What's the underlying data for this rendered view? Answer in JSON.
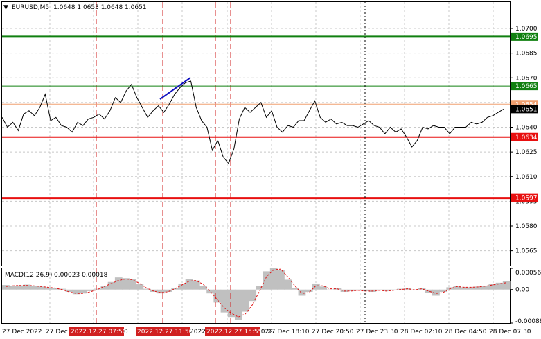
{
  "header": {
    "menu_glyph": "▼",
    "symbol": "EURUSD,M5",
    "ohlc": "1.0648 1.0653 1.0648 1.0651"
  },
  "indicator": {
    "label": "MACD(12,26,9)",
    "values": "0.00023 0.00018"
  },
  "colors": {
    "price_line": "#000000",
    "resistance": "#108010",
    "support": "#e81010",
    "bid": "#f0a070",
    "grid": "#c8c8c8",
    "event_line": "#d02020",
    "macd_hist": "#c0c0c0",
    "signal": "#e01010",
    "trend_line": "#1010c0",
    "current_price_tag": "#000000"
  },
  "chart_data": {
    "type": "line",
    "price_axis_ticks": [
      "1.0700",
      "1.0685",
      "1.0670",
      "1.0655",
      "1.0640",
      "1.0625",
      "1.0610",
      "1.0595",
      "1.0580",
      "1.0565"
    ],
    "time_axis_labels": [
      "27 Dec 2022",
      "27 Dec",
      "0",
      "27 Dec 18:10",
      "27 Dec 20:50",
      "27 Dec 23:30",
      "28 Dec 02:10",
      "28 Dec 04:50",
      "28 Dec 07:30"
    ],
    "highlighted_time_labels": [
      "2022.12.27 07:50",
      "2022.12.27 11:50",
      "2022.12.27 15:55"
    ],
    "time_partial_labels": [
      "2022",
      "2022"
    ],
    "price_ylim": [
      1.0556,
      1.0716
    ],
    "levels": [
      {
        "value": 1.0695,
        "label": "1.0695",
        "kind": "resistance",
        "width": 3
      },
      {
        "value": 1.0665,
        "label": "1.0665",
        "kind": "resistance",
        "width": 1
      },
      {
        "value": 1.0654,
        "label": "1.0654",
        "kind": "bid",
        "width": 1
      },
      {
        "value": 1.0634,
        "label": "1.0634",
        "kind": "support",
        "width": 2
      },
      {
        "value": 1.0597,
        "label": "1.0597",
        "kind": "support",
        "width": 3
      }
    ],
    "current_price": {
      "value": 1.0651,
      "label": "1.0651"
    },
    "price_series": [
      1.0646,
      1.064,
      1.0643,
      1.0638,
      1.0648,
      1.065,
      1.0647,
      1.0652,
      1.066,
      1.0644,
      1.0646,
      1.0641,
      1.064,
      1.0637,
      1.0643,
      1.0641,
      1.0645,
      1.0646,
      1.0648,
      1.0645,
      1.065,
      1.0658,
      1.0655,
      1.0662,
      1.0666,
      1.0658,
      1.0652,
      1.0646,
      1.065,
      1.0653,
      1.0649,
      1.0654,
      1.066,
      1.0664,
      1.0667,
      1.0668,
      1.0652,
      1.0644,
      1.064,
      1.0626,
      1.0632,
      1.0622,
      1.0618,
      1.0627,
      1.0645,
      1.0652,
      1.0649,
      1.0652,
      1.0655,
      1.0646,
      1.065,
      1.064,
      1.0637,
      1.0641,
      1.064,
      1.0644,
      1.0644,
      1.065,
      1.0656,
      1.0646,
      1.0643,
      1.0645,
      1.0642,
      1.0643,
      1.0641,
      1.0641,
      1.064,
      1.0642,
      1.0644,
      1.0641,
      1.064,
      1.0636,
      1.064,
      1.0637,
      1.0639,
      1.0634,
      1.0628,
      1.0632,
      1.064,
      1.0639,
      1.0641,
      1.064,
      1.064,
      1.0636,
      1.064,
      1.064,
      1.064,
      1.0643,
      1.0642,
      1.0643,
      1.0646,
      1.0647,
      1.0649,
      1.0651
    ],
    "macd_ylim": [
      -0.00088,
      0.00056
    ],
    "macd_ticks": [
      "0.00056",
      "0.00",
      "-0.00088"
    ],
    "macd_histogram": [
      0.00012,
      0.0001,
      0.00011,
      0.00013,
      0.0001,
      8e-05,
      6e-05,
      4e-05,
      2e-05,
      -6e-05,
      -0.00012,
      -0.0001,
      -4e-05,
      2e-05,
      0.0001,
      0.0002,
      0.00032,
      0.0003,
      0.00028,
      0.00014,
      2e-05,
      -6e-05,
      -0.0001,
      -6e-05,
      4e-05,
      0.00016,
      0.00028,
      0.00024,
      0.0001,
      -0.0001,
      -0.00034,
      -0.0006,
      -0.00072,
      -0.0008,
      -0.00058,
      -0.0003,
      0.0001,
      0.00048,
      0.00056,
      0.00052,
      0.00026,
      4e-05,
      -0.00016,
      -6e-05,
      0.00016,
      8e-05,
      -2e-05,
      4e-05,
      -6e-05,
      -4e-05,
      -2e-05,
      -4e-05,
      -6e-05,
      -2e-05,
      -4e-05,
      -2e-05,
      2e-05,
      4e-05,
      -2e-05,
      4e-05,
      -8e-05,
      -0.00016,
      -6e-05,
      6e-05,
      0.0001,
      6e-05,
      6e-05,
      8e-05,
      0.0001,
      0.00014,
      0.00018,
      0.00023
    ],
    "macd_signal": [
      8e-05,
      0.0001,
      0.00011,
      0.00011,
      0.0001,
      8e-05,
      6e-05,
      4e-05,
      0.0,
      -6e-05,
      -0.0001,
      -0.0001,
      -6e-05,
      0.0,
      8e-05,
      0.00016,
      0.00024,
      0.00028,
      0.00026,
      0.00016,
      4e-05,
      -4e-05,
      -8e-05,
      -6e-05,
      2e-05,
      0.00012,
      0.00022,
      0.00024,
      0.00014,
      -4e-05,
      -0.00026,
      -0.00048,
      -0.00062,
      -0.00072,
      -0.00064,
      -0.0004,
      -4e-05,
      0.00034,
      0.00052,
      0.00054,
      0.00034,
      0.0001,
      -0.0001,
      -8e-05,
      0.0001,
      0.0001,
      2e-05,
      2e-05,
      -4e-05,
      -4e-05,
      -2e-05,
      -4e-05,
      -4e-05,
      -2e-05,
      -4e-05,
      -2e-05,
      0.0,
      2e-05,
      -1e-05,
      2e-05,
      -4e-05,
      -0.0001,
      -8e-05,
      2e-05,
      8e-05,
      6e-05,
      6e-05,
      7e-05,
      9e-05,
      0.00012,
      0.00015,
      0.00018
    ]
  }
}
